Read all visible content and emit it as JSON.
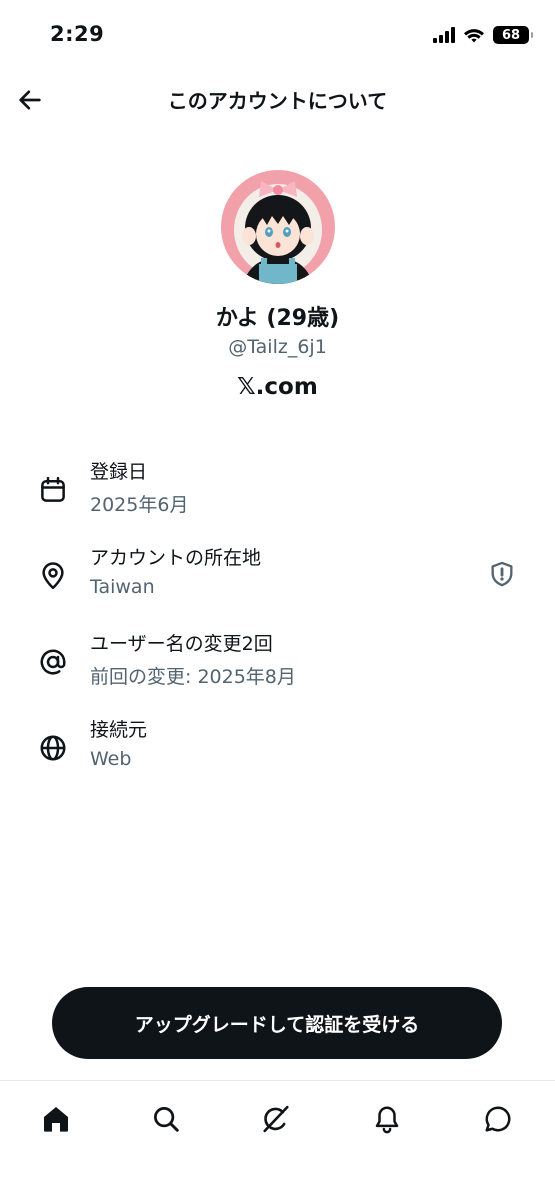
{
  "status_bar": {
    "time": "2:29",
    "battery": "68"
  },
  "header": {
    "title": "このアカウントについて"
  },
  "profile": {
    "display_name": "かよ (29歳)",
    "handle": "@Tailz_6j1",
    "site": "𝕏.com"
  },
  "info": [
    {
      "icon": "calendar-icon",
      "title": "登録日",
      "subtitle": "2025年6月"
    },
    {
      "icon": "location-pin-icon",
      "title": "アカウントの所在地",
      "subtitle": "Taiwan",
      "badge": "shield-info-icon"
    },
    {
      "icon": "at-sign-icon",
      "title": "ユーザー名の変更2回",
      "subtitle": "前回の変更: 2025年8月"
    },
    {
      "icon": "globe-icon",
      "title": "接続元",
      "subtitle": "Web"
    }
  ],
  "upgrade_button": {
    "label": "アップグレードして認証を受ける"
  },
  "bottom_nav": [
    "home-icon",
    "search-icon",
    "grok-icon",
    "bell-icon",
    "messages-icon"
  ],
  "colors": {
    "primary": "#0f1419",
    "secondary_text": "#536471",
    "background": "#ffffff"
  }
}
